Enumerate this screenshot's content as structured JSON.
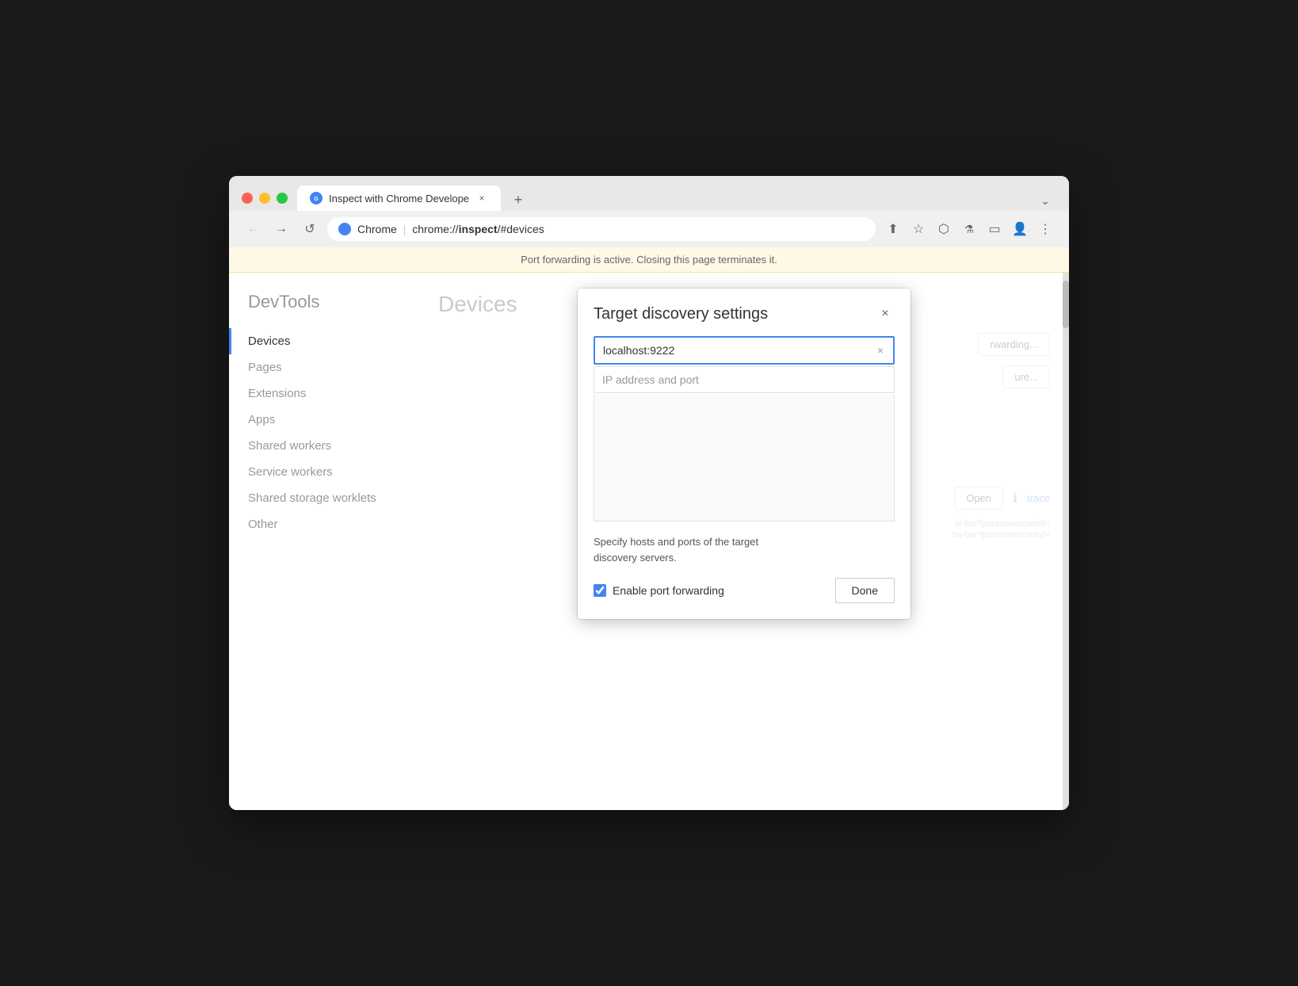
{
  "browser": {
    "window_controls": {
      "close_label": "×",
      "minimize_label": "−",
      "maximize_label": "+"
    },
    "tab": {
      "title": "Inspect with Chrome Develope",
      "favicon_symbol": "G",
      "close_label": "×"
    },
    "tab_new_label": "+",
    "tab_chevron": "⌄",
    "nav": {
      "back_label": "←",
      "forward_label": "→",
      "reload_label": "↺"
    },
    "address_bar": {
      "site_label": "Chrome",
      "url_prefix": "chrome://",
      "url_bold": "inspect",
      "url_suffix": "/#devices",
      "favicon_symbol": "G"
    },
    "toolbar": {
      "share_icon": "↑",
      "bookmark_icon": "☆",
      "extension_icon": "⬡",
      "devtools_icon": "🔬",
      "split_icon": "⬜",
      "profile_icon": "👤",
      "menu_icon": "⋮"
    }
  },
  "notification_banner": {
    "text": "Port forwarding is active. Closing this page terminates it."
  },
  "sidebar": {
    "title": "DevTools",
    "items": [
      {
        "label": "Devices",
        "active": true
      },
      {
        "label": "Pages",
        "active": false
      },
      {
        "label": "Extensions",
        "active": false
      },
      {
        "label": "Apps",
        "active": false
      },
      {
        "label": "Shared workers",
        "active": false
      },
      {
        "label": "Service workers",
        "active": false
      },
      {
        "label": "Shared storage worklets",
        "active": false
      },
      {
        "label": "Other",
        "active": false
      }
    ]
  },
  "main": {
    "page_title": "Devices",
    "bg_button1": "rwarding...",
    "bg_button2": "ure...",
    "bg_button3": "Open",
    "bg_link1": "trace",
    "bg_text1": "le-bar?paramsencoded=",
    "bg_text2": "he-bar?paramsencoded="
  },
  "dialog": {
    "title": "Target discovery settings",
    "close_label": "×",
    "input_value": "localhost:9222",
    "input_clear_label": "×",
    "input_placeholder": "IP address and port",
    "description": "Specify hosts and ports of the target\ndiscovery servers.",
    "checkbox_label": "Enable port forwarding",
    "checkbox_checked": true,
    "done_label": "Done"
  }
}
